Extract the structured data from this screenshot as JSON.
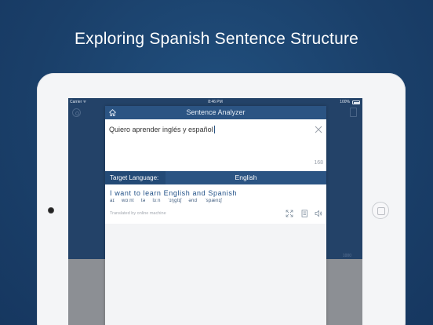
{
  "headline": "Exploring Spanish Sentence Structure",
  "status_bar": {
    "carrier": "Carrier ᯤ",
    "time": "8:46 PM",
    "battery": "100%"
  },
  "background_app": {
    "counter": "1000"
  },
  "modal": {
    "title": "Sentence Analyzer",
    "input_text": "Quiero aprender inglés y español",
    "char_count": "168",
    "target_language_label": "Target Language:",
    "target_language": "English",
    "translation_words": "I  want  to  learn  English  and  Spanish",
    "phonetics": [
      "aɪ",
      "wɑːnt",
      "tə",
      "lɜːn",
      "ˈɪŋglɪʃ",
      "ənd",
      "ˈspænɪʃ"
    ],
    "machine_note": "Translated by online machine"
  },
  "icons": {
    "home": "home-icon",
    "clear": "close-icon",
    "expand": "expand-icon",
    "notes": "document-icon",
    "speaker": "speaker-icon",
    "settings": "gear-icon",
    "book": "book-icon"
  },
  "colors": {
    "background": "#1d4471",
    "header": "#2b5483",
    "accent_text": "#1f4f86"
  }
}
